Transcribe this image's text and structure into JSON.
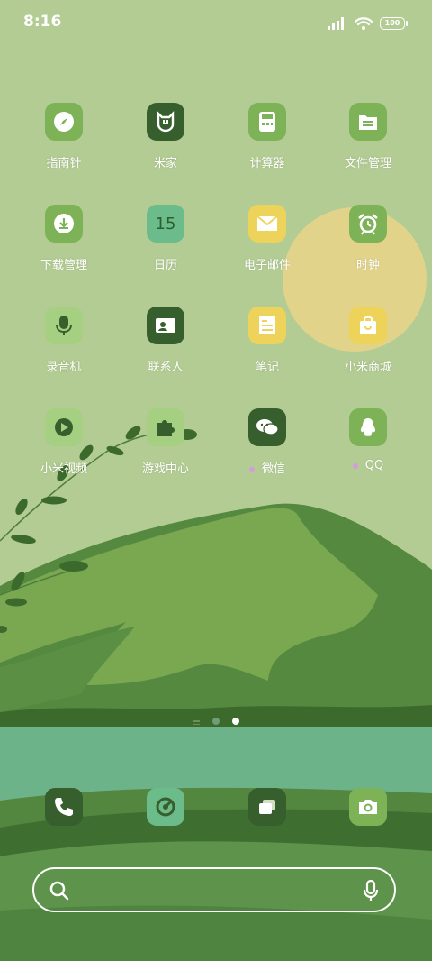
{
  "status_bar": {
    "time": "8:16",
    "battery": "100"
  },
  "home": {
    "apps": [
      {
        "label": "指南针",
        "icon": "compass-icon"
      },
      {
        "label": "米家",
        "icon": "mijia-icon"
      },
      {
        "label": "计算器",
        "icon": "calculator-icon"
      },
      {
        "label": "文件管理",
        "icon": "file-manager-icon"
      },
      {
        "label": "下载管理",
        "icon": "download-icon"
      },
      {
        "label": "日历",
        "icon": "calendar-icon",
        "icon_text": "15"
      },
      {
        "label": "电子邮件",
        "icon": "mail-icon"
      },
      {
        "label": "时钟",
        "icon": "alarm-clock-icon"
      },
      {
        "label": "录音机",
        "icon": "microphone-icon"
      },
      {
        "label": "联系人",
        "icon": "contacts-icon"
      },
      {
        "label": "笔记",
        "icon": "notes-icon"
      },
      {
        "label": "小米商城",
        "icon": "shopping-bag-icon"
      },
      {
        "label": "小米视频",
        "icon": "video-icon"
      },
      {
        "label": "游戏中心",
        "icon": "puzzle-icon"
      },
      {
        "label": "微信",
        "icon": "wechat-icon",
        "new_badge": true
      },
      {
        "label": "QQ",
        "icon": "qq-icon",
        "new_badge": true
      }
    ],
    "page_indicator": {
      "pages": 2,
      "current": 2
    }
  },
  "dock": [
    {
      "icon": "phone-icon"
    },
    {
      "icon": "browser-icon"
    },
    {
      "icon": "multitask-icon"
    },
    {
      "icon": "camera-icon"
    }
  ],
  "colors": {
    "sky": "#b3cc93",
    "icon_light_green": "#7db257",
    "icon_dark_green": "#375f2d",
    "icon_yellow": "#eed35a",
    "icon_mint": "#6cbb8a",
    "lake": "#6db38a",
    "new_badge": "#d59bdc"
  }
}
